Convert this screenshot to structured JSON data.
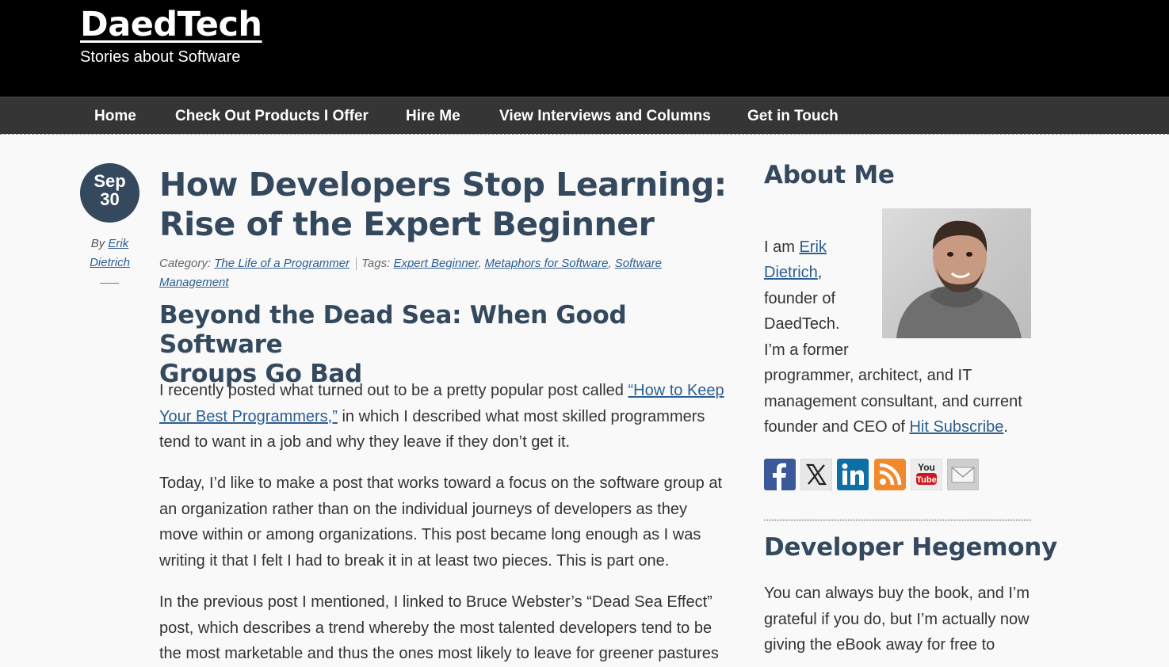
{
  "site": {
    "title": "DaedTech",
    "tagline": "Stories about Software"
  },
  "nav": {
    "items": [
      {
        "label": "Home"
      },
      {
        "label": "Check Out Products I Offer"
      },
      {
        "label": "Hire Me"
      },
      {
        "label": "View Interviews and Columns"
      },
      {
        "label": "Get in Touch"
      }
    ]
  },
  "post": {
    "date_month": "Sep",
    "date_day": "30",
    "byline_prefix": "By",
    "author_first": "Erik",
    "author_last": "Dietrich",
    "title_line1": "How Developers Stop Learning:",
    "title_line2": "Rise of the Expert Beginner",
    "category_label": "Category:",
    "category": "The Life of a Programmer",
    "tags_label": "Tags:",
    "tags": [
      "Expert Beginner",
      "Metaphors for Software",
      "Software",
      "Management"
    ],
    "subtitle_line1": "Beyond the Dead Sea: When Good Software",
    "subtitle_line2": "Groups Go Bad",
    "p1_before": "I recently posted what turned out to be a pretty popular post called ",
    "p1_link": "“How to Keep Your Best Programmers,”",
    "p1_after": " in which I described what most skilled programmers tend to want in a job and why they leave if they don’t get it.",
    "p2": "Today, I’d like to make a post that works toward a focus on the software group at an organization rather than on the individual journeys of developers as they move within or among organizations. This post became long enough as I was writing it that I felt I had to break it in at least two pieces. This is part one.",
    "p3": "In the previous post I mentioned, I linked to Bruce Webster’s “Dead Sea Effect” post, which describes a trend whereby the most talented developers tend to be the most marketable and thus the ones most likely to leave for greener pastures"
  },
  "sidebar": {
    "about_title": "About Me",
    "about_intro": "I am ",
    "about_name_first": "Erik",
    "about_name_last": "Dietrich",
    "about_l3": "founder of",
    "about_l4": "DaedTech.",
    "about_l5": "I’m a former",
    "about_l6": "programmer, architect, and IT",
    "about_l7": "management consultant, and current",
    "about_l8_before": "founder and CEO of ",
    "about_l8_link": "Hit Subscribe",
    "social_icons": [
      "facebook-icon",
      "x-icon",
      "linkedin-icon",
      "rss-icon",
      "youtube-icon",
      "email-icon"
    ],
    "hegemony_title": "Developer Hegemony",
    "hegemony_l1": "You can always buy the book, and I’m",
    "hegemony_l2": "grateful if you do, but I’m actually now",
    "hegemony_l3": "giving the eBook away for free to"
  },
  "colors": {
    "accent": "#34495e",
    "link": "#2b5e91",
    "header_bg": "#000000",
    "nav_bg": "#353535"
  }
}
